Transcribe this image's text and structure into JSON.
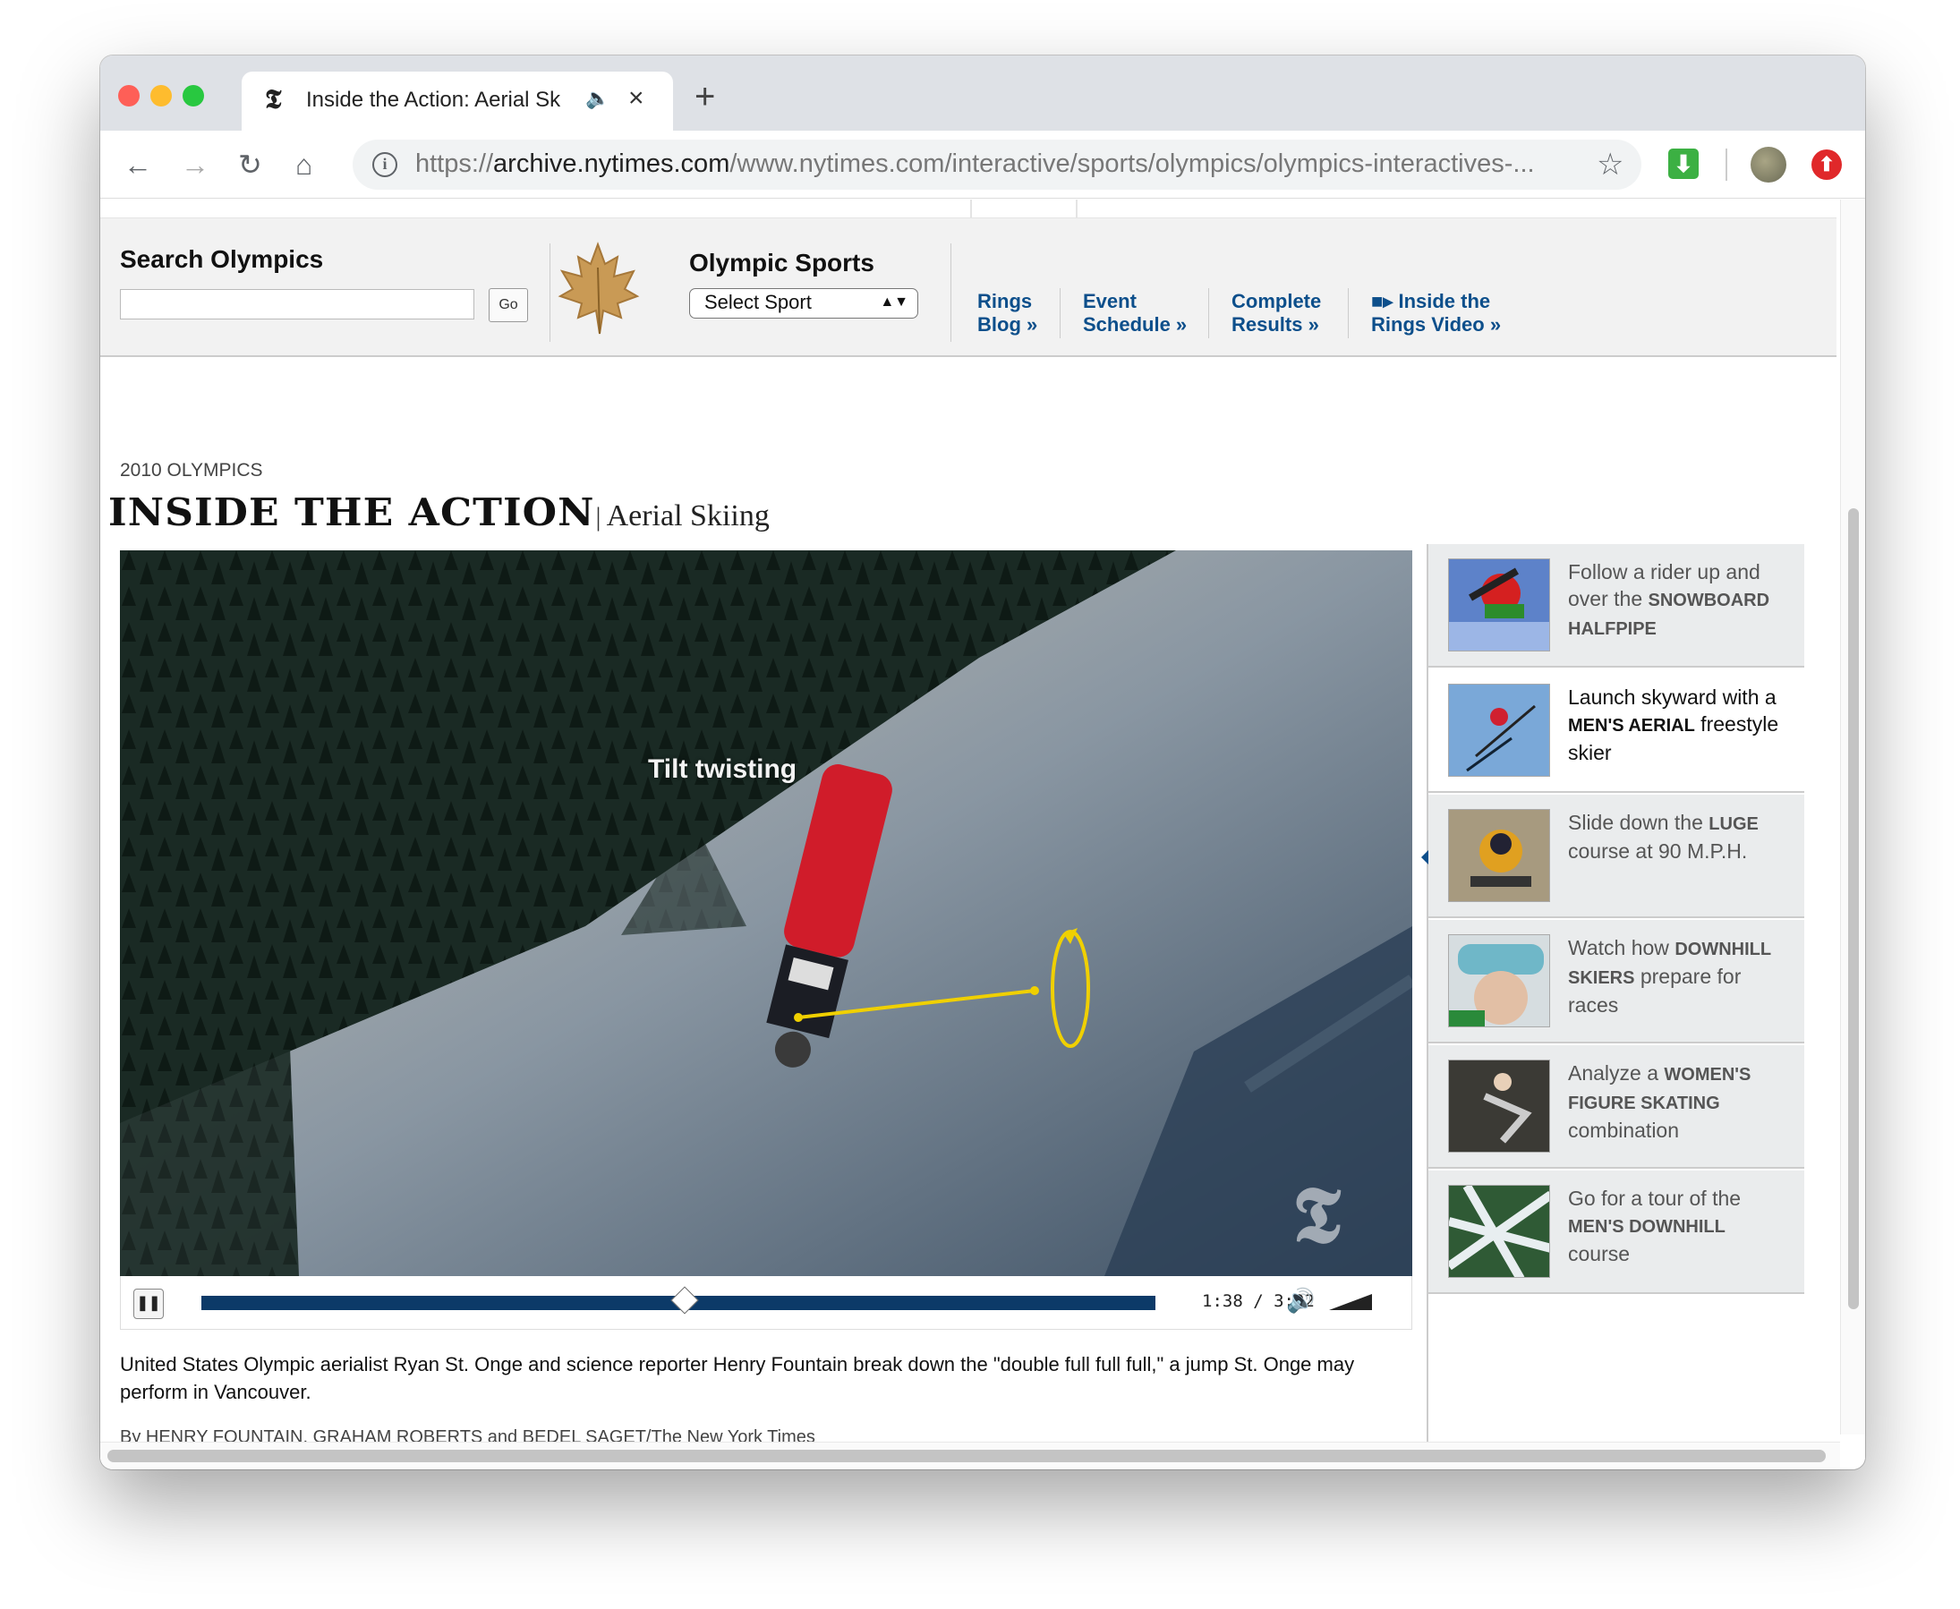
{
  "browser": {
    "tab_title": "Inside the Action: Aerial Sk",
    "tab_favicon": "nyt-t-icon",
    "url_scheme": "https://",
    "url_host": "archive.nytimes.com",
    "url_path": "/www.nytimes.com/interactive/sports/olympics/olympics-interactives-...",
    "new_tab": "+"
  },
  "nav": {
    "search_title": "Search Olympics",
    "search_value": "",
    "go_label": "Go",
    "sports_title": "Olympic Sports",
    "sport_select": "Select Sport",
    "links": [
      {
        "line1": "Rings",
        "line2": "Blog »"
      },
      {
        "line1": "Event",
        "line2": "Schedule »"
      },
      {
        "line1": "Complete",
        "line2": "Results »"
      },
      {
        "line1": "Inside the",
        "line2": "Rings Video »"
      }
    ]
  },
  "article": {
    "kicker": "2010 OLYMPICS",
    "headline": "INSIDE THE ACTION",
    "pipe": "|",
    "subhead": "Aerial Skiing",
    "video_overlay": "Tilt twisting",
    "watermark": "𝕿",
    "time": "1:38 / 3:02",
    "progress": 0.507,
    "caption": "United States Olympic aerialist Ryan St. Onge and science reporter Henry Fountain break down the \"double full full full,\" a jump St. Onge may perform in Vancouver.",
    "byline": "By HENRY FOUNTAIN, GRAHAM ROBERTS and BEDEL SAGET/The New York Times"
  },
  "sidebar": [
    {
      "pre": "Follow a rider up and over the ",
      "bold": "SNOWBOARD HALFPIPE",
      "post": ""
    },
    {
      "pre": "Launch skyward with a ",
      "bold": "MEN'S AERIAL",
      "post": " freestyle skier"
    },
    {
      "pre": "Slide down the ",
      "bold": "LUGE",
      "post": " course at 90 M.P.H."
    },
    {
      "pre": "Watch how ",
      "bold": "DOWNHILL SKIERS",
      "post": " prepare for races"
    },
    {
      "pre": "Analyze a ",
      "bold": "WOMEN'S FIGURE SKATING",
      "post": " combination"
    },
    {
      "pre": "Go for a tour of the ",
      "bold": "MEN'S DOWNHILL",
      "post": " course"
    }
  ],
  "colors": {
    "link": "#0d4f8b",
    "seek": "#0c3a68",
    "accent_yellow": "#f0d000",
    "skier_red": "#d01c2a"
  }
}
